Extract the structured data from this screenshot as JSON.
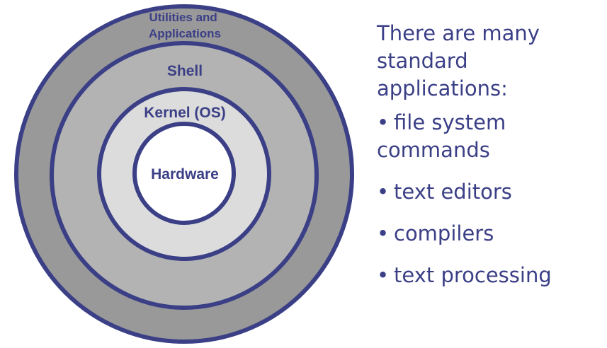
{
  "diagram": {
    "rings": [
      {
        "id": "utilities",
        "label_lines": [
          "Utilities and",
          "Applications"
        ],
        "fill": "#999999"
      },
      {
        "id": "shell",
        "label_lines": [
          "Shell"
        ],
        "fill": "#b3b3b3"
      },
      {
        "id": "kernel",
        "label_lines": [
          "Kernel (OS)"
        ],
        "fill": "#dcdcdc"
      },
      {
        "id": "hardware",
        "label_lines": [
          "Hardware"
        ],
        "fill": "#ffffff"
      }
    ],
    "stroke_color": "#3b3f86"
  },
  "text": {
    "intro": "There are many standard applications:",
    "bullets": [
      "file system commands",
      "text editors",
      "compilers",
      "text processing"
    ],
    "bullet_symbol": "•",
    "color": "#3b3f86"
  }
}
